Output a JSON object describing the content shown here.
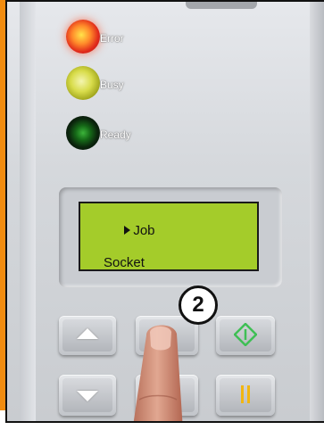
{
  "leds": {
    "error_label": "Error",
    "busy_label": "Busy",
    "ready_label": "Ready"
  },
  "lcd": {
    "line1": "Job",
    "line2": "Socket"
  },
  "callout": {
    "step_number": "2"
  },
  "keys": {
    "up_icon": "arrow-up-icon",
    "down_icon": "arrow-down-icon",
    "enter_icon": "enter-key",
    "start_icon": "start-diamond-icon",
    "pause_icon": "pause-icon"
  },
  "colors": {
    "accent_strip": "#f18c10",
    "lcd_background": "#a4cc2a",
    "start_icon": "#3fbf55",
    "pause_icon": "#f2b611"
  }
}
